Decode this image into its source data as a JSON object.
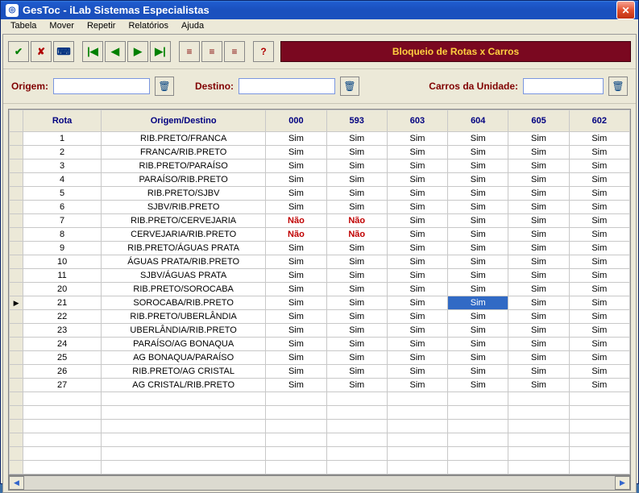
{
  "window": {
    "title": "GesToc - iLab Sistemas Especialistas"
  },
  "menu": {
    "items": [
      "Tabela",
      "Mover",
      "Repetir",
      "Relatórios",
      "Ajuda"
    ]
  },
  "banner": "Bloqueio de Rotas x Carros",
  "filters": {
    "origem_label": "Origem:",
    "origem_value": "",
    "destino_label": "Destino:",
    "destino_value": "",
    "carros_label": "Carros da Unidade:",
    "carros_value": ""
  },
  "grid": {
    "columns": [
      "Rota",
      "Origem/Destino",
      "000",
      "593",
      "603",
      "604",
      "605",
      "602"
    ],
    "selected_row": 13,
    "selected_col": 5,
    "rows": [
      {
        "rota": "1",
        "od": "RIB.PRETO/FRANCA",
        "v": [
          "Sim",
          "Sim",
          "Sim",
          "Sim",
          "Sim",
          "Sim"
        ]
      },
      {
        "rota": "2",
        "od": "FRANCA/RIB.PRETO",
        "v": [
          "Sim",
          "Sim",
          "Sim",
          "Sim",
          "Sim",
          "Sim"
        ]
      },
      {
        "rota": "3",
        "od": "RIB.PRETO/PARAÍSO",
        "v": [
          "Sim",
          "Sim",
          "Sim",
          "Sim",
          "Sim",
          "Sim"
        ]
      },
      {
        "rota": "4",
        "od": "PARAÍSO/RIB.PRETO",
        "v": [
          "Sim",
          "Sim",
          "Sim",
          "Sim",
          "Sim",
          "Sim"
        ]
      },
      {
        "rota": "5",
        "od": "RIB.PRETO/SJBV",
        "v": [
          "Sim",
          "Sim",
          "Sim",
          "Sim",
          "Sim",
          "Sim"
        ]
      },
      {
        "rota": "6",
        "od": "SJBV/RIB.PRETO",
        "v": [
          "Sim",
          "Sim",
          "Sim",
          "Sim",
          "Sim",
          "Sim"
        ]
      },
      {
        "rota": "7",
        "od": "RIB.PRETO/CERVEJARIA",
        "v": [
          "Não",
          "Não",
          "Sim",
          "Sim",
          "Sim",
          "Sim"
        ]
      },
      {
        "rota": "8",
        "od": "CERVEJARIA/RIB.PRETO",
        "v": [
          "Não",
          "Não",
          "Sim",
          "Sim",
          "Sim",
          "Sim"
        ]
      },
      {
        "rota": "9",
        "od": "RIB.PRETO/ÁGUAS PRATA",
        "v": [
          "Sim",
          "Sim",
          "Sim",
          "Sim",
          "Sim",
          "Sim"
        ]
      },
      {
        "rota": "10",
        "od": "ÁGUAS PRATA/RIB.PRETO",
        "v": [
          "Sim",
          "Sim",
          "Sim",
          "Sim",
          "Sim",
          "Sim"
        ]
      },
      {
        "rota": "11",
        "od": "SJBV/ÁGUAS PRATA",
        "v": [
          "Sim",
          "Sim",
          "Sim",
          "Sim",
          "Sim",
          "Sim"
        ]
      },
      {
        "rota": "20",
        "od": "RIB.PRETO/SOROCABA",
        "v": [
          "Sim",
          "Sim",
          "Sim",
          "Sim",
          "Sim",
          "Sim"
        ]
      },
      {
        "rota": "21",
        "od": "SOROCABA/RIB.PRETO",
        "v": [
          "Sim",
          "Sim",
          "Sim",
          "Sim",
          "Sim",
          "Sim"
        ]
      },
      {
        "rota": "22",
        "od": "RIB.PRETO/UBERLÂNDIA",
        "v": [
          "Sim",
          "Sim",
          "Sim",
          "Sim",
          "Sim",
          "Sim"
        ]
      },
      {
        "rota": "23",
        "od": "UBERLÂNDIA/RIB.PRETO",
        "v": [
          "Sim",
          "Sim",
          "Sim",
          "Sim",
          "Sim",
          "Sim"
        ]
      },
      {
        "rota": "24",
        "od": "PARAÍSO/AG BONAQUA",
        "v": [
          "Sim",
          "Sim",
          "Sim",
          "Sim",
          "Sim",
          "Sim"
        ]
      },
      {
        "rota": "25",
        "od": "AG BONAQUA/PARAÍSO",
        "v": [
          "Sim",
          "Sim",
          "Sim",
          "Sim",
          "Sim",
          "Sim"
        ]
      },
      {
        "rota": "26",
        "od": "RIB.PRETO/AG CRISTAL",
        "v": [
          "Sim",
          "Sim",
          "Sim",
          "Sim",
          "Sim",
          "Sim"
        ]
      },
      {
        "rota": "27",
        "od": "AG CRISTAL/RIB.PRETO",
        "v": [
          "Sim",
          "Sim",
          "Sim",
          "Sim",
          "Sim",
          "Sim"
        ]
      }
    ]
  },
  "toolbar_icons": {
    "confirm": "✔",
    "cancel": "✘",
    "keyboard": "⌨",
    "first": "|◀",
    "prev": "◀",
    "next": "▶",
    "last": "▶|",
    "list1": "≡",
    "list2": "≡",
    "list3": "≡",
    "help": "?"
  }
}
